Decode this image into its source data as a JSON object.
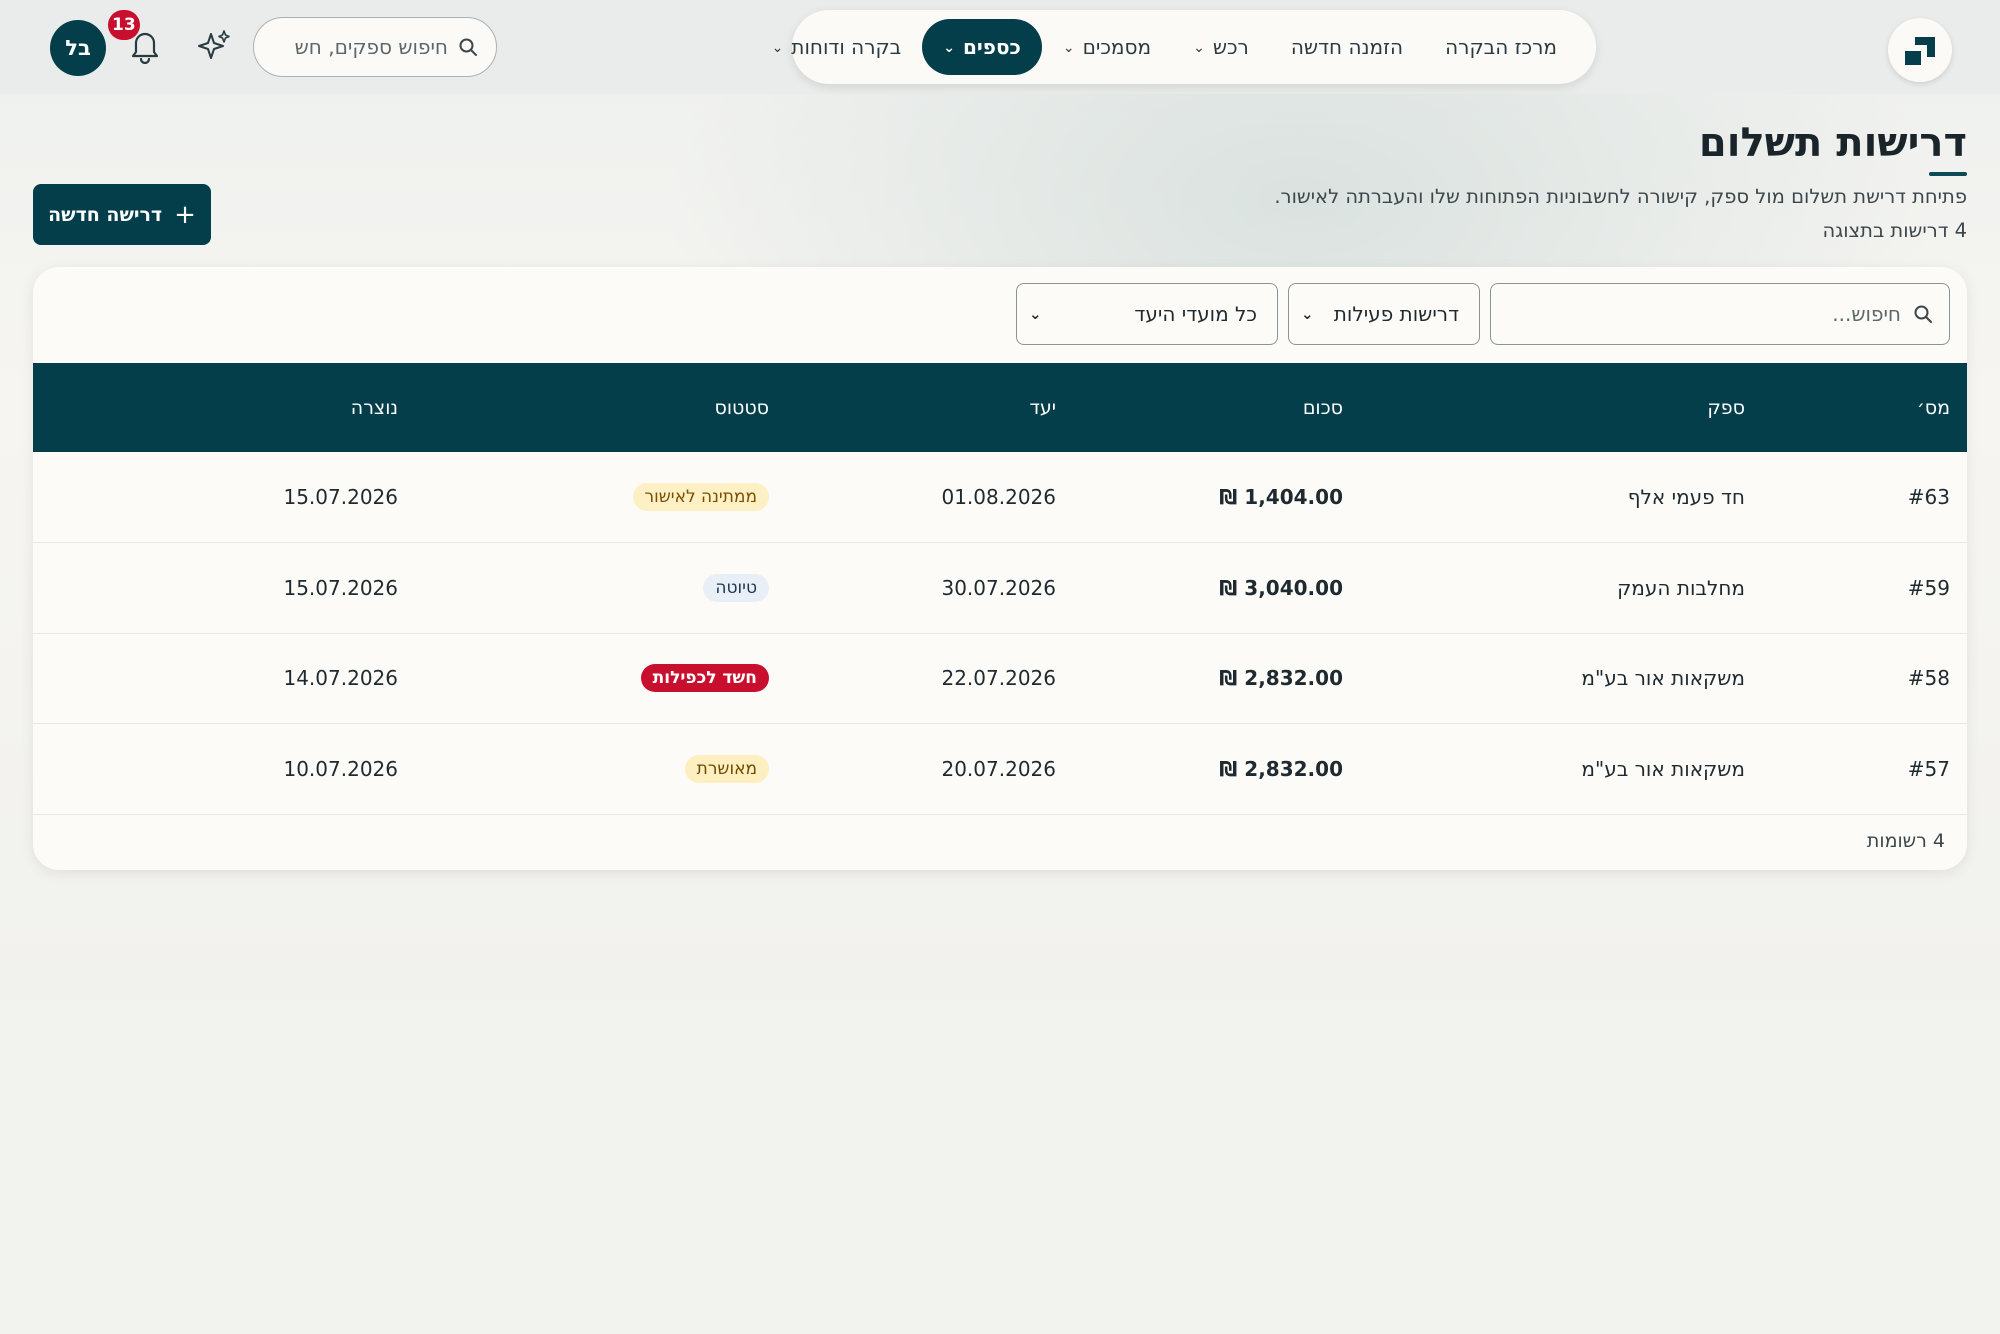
{
  "header": {
    "nav": [
      {
        "label": "מרכז הבקרה",
        "dropdown": false,
        "active": false
      },
      {
        "label": "הזמנה חדשה",
        "dropdown": false,
        "active": false
      },
      {
        "label": "רכש",
        "dropdown": true,
        "active": false
      },
      {
        "label": "מסמכים",
        "dropdown": true,
        "active": false
      },
      {
        "label": "כספים",
        "dropdown": true,
        "active": true
      },
      {
        "label": "בקרה ודוחות",
        "dropdown": true,
        "active": false
      }
    ],
    "search_placeholder": "חיפוש ספקים, חש",
    "notification_count": "13",
    "avatar_initials": "בל"
  },
  "page": {
    "title": "דרישות תשלום",
    "subtitle": "פתיחת דרישת תשלום מול ספק, קישורה לחשבוניות הפתוחות שלו והעברתה לאישור.",
    "count_text": "4 דרישות בתצוגה",
    "new_button": "דרישה חדשה"
  },
  "filters": {
    "search_placeholder": "חיפוש...",
    "status_select": "דרישות פעילות",
    "target_select": "כל מועדי היעד"
  },
  "table": {
    "columns": [
      "מס׳",
      "ספק",
      "סכום",
      "יעד",
      "סטטוס",
      "נוצרה"
    ],
    "rows": [
      {
        "num": "#63",
        "supplier": "חד פעמי אלף",
        "amount": "1,404.00 ₪",
        "target": "01.08.2026",
        "status": "ממתינה לאישור",
        "status_kind": "pending",
        "created": "15.07.2026"
      },
      {
        "num": "#59",
        "supplier": "מחלבות העמק",
        "amount": "3,040.00 ₪",
        "target": "30.07.2026",
        "status": "טיוטה",
        "status_kind": "draft",
        "created": "15.07.2026"
      },
      {
        "num": "#58",
        "supplier": "משקאות אור בע\"מ",
        "amount": "2,832.00 ₪",
        "target": "22.07.2026",
        "status": "חשד לכפילות",
        "status_kind": "duplicate",
        "created": "14.07.2026"
      },
      {
        "num": "#57",
        "supplier": "משקאות אור בע\"מ",
        "amount": "2,832.00 ₪",
        "target": "20.07.2026",
        "status": "מאושרת",
        "status_kind": "approved",
        "created": "10.07.2026"
      }
    ],
    "footer": "4 רשומות"
  },
  "colors": {
    "primary": "#033e4a",
    "badge_red": "#c8102e",
    "pending_bg": "#fdf0c4",
    "pending_fg": "#7a4f00",
    "draft_bg": "#e9eff6",
    "draft_fg": "#1f3550",
    "duplicate_bg": "#c8102e",
    "duplicate_fg": "#ffffff",
    "approved_bg": "#fdefc0",
    "approved_fg": "#6e4a00"
  }
}
